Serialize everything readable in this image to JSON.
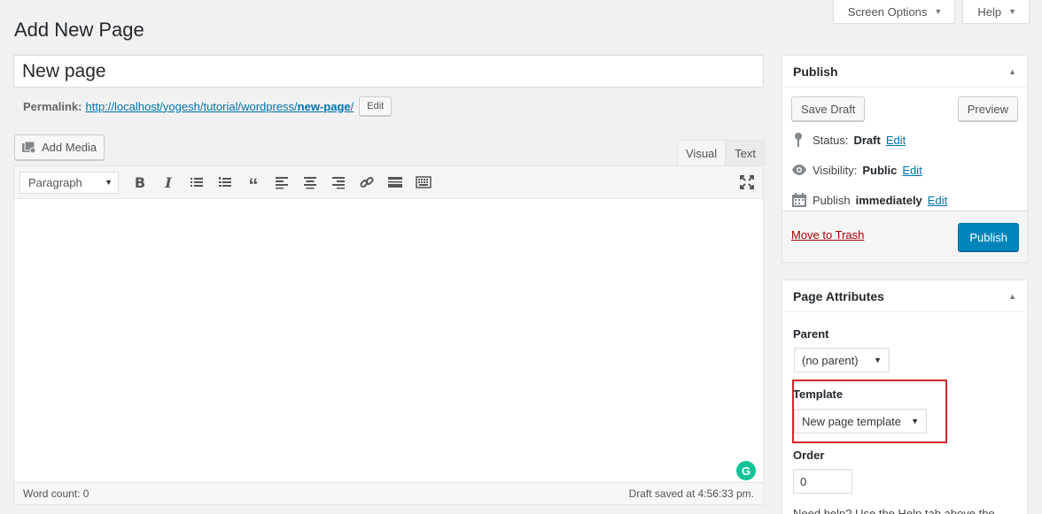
{
  "screen_tabs": {
    "screen_options": "Screen Options",
    "help": "Help"
  },
  "page": {
    "title": "Add New Page"
  },
  "post": {
    "title_value": "New page",
    "permalink_label": "Permalink:",
    "permalink_base": "http://localhost/yogesh/tutorial/wordpress/",
    "permalink_slug": "new-page",
    "permalink_trailing": "/",
    "permalink_edit": "Edit"
  },
  "editor": {
    "add_media": "Add Media",
    "tab_visual": "Visual",
    "tab_text": "Text",
    "format_select": "Paragraph",
    "word_count": "Word count: 0",
    "draft_saved": "Draft saved at 4:56:33 pm.",
    "grammarly": "G"
  },
  "publish": {
    "header": "Publish",
    "save_draft": "Save Draft",
    "preview": "Preview",
    "status_label": "Status:",
    "status_value": "Draft",
    "visibility_label": "Visibility:",
    "visibility_value": "Public",
    "publish_label": "Publish",
    "publish_value": "immediately",
    "edit": "Edit",
    "move_to_trash": "Move to Trash",
    "publish_button": "Publish"
  },
  "attributes": {
    "header": "Page Attributes",
    "parent_label": "Parent",
    "parent_value": "(no parent)",
    "template_label": "Template",
    "template_value": "New page template",
    "order_label": "Order",
    "order_value": "0",
    "help_text": "Need help? Use the Help tab above the"
  },
  "colors": {
    "primary": "#0085ba",
    "link": "#0073aa",
    "trash": "#a00",
    "highlight": "#d9252a"
  }
}
